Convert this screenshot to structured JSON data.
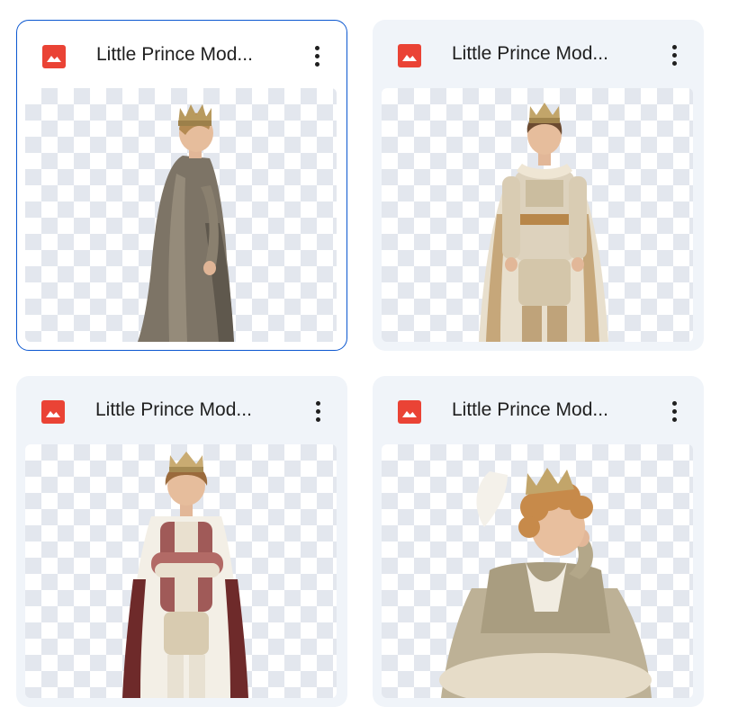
{
  "files": [
    {
      "title": "Little Prince Mod...",
      "icon": "image-file-icon",
      "selected": true
    },
    {
      "title": "Little Prince Mod...",
      "icon": "image-file-icon",
      "selected": false
    },
    {
      "title": "Little Prince Mod...",
      "icon": "image-file-icon",
      "selected": false
    },
    {
      "title": "Little Prince Mod...",
      "icon": "image-file-icon",
      "selected": false
    }
  ],
  "colors": {
    "accent": "#0b57d0",
    "card_background": "#f0f4f9",
    "icon_red": "#ea4335"
  }
}
